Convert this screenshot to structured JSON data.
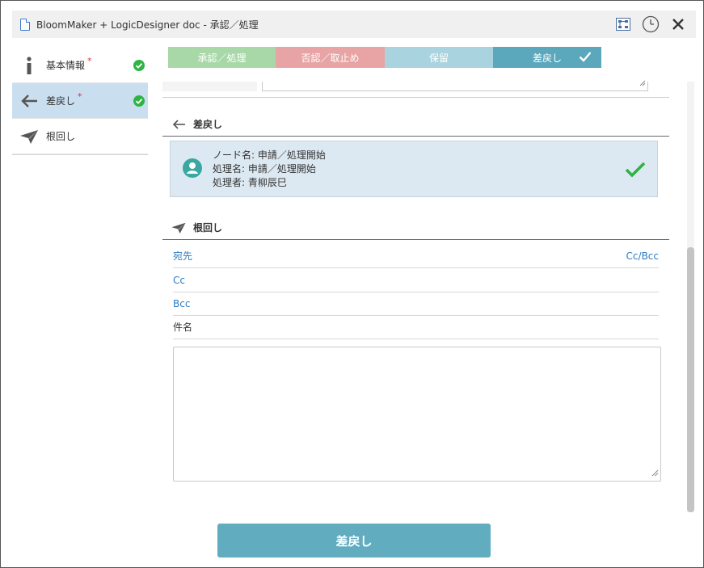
{
  "window": {
    "title": "BloomMaker + LogicDesigner doc - 承認／処理"
  },
  "sidebar": {
    "items": [
      {
        "label": "基本情報",
        "required_mark": "*",
        "icon": "info-icon",
        "status_icon": "check-circle-icon"
      },
      {
        "label": "差戻し",
        "required_mark": "*",
        "icon": "arrow-left-icon",
        "status_icon": "check-circle-icon"
      },
      {
        "label": "根回し",
        "icon": "paper-plane-icon"
      }
    ]
  },
  "actions": [
    {
      "label": "承認／処理",
      "color": "#a8d8a8"
    },
    {
      "label": "否認／取止め",
      "color": "#e8a4a4"
    },
    {
      "label": "保留",
      "color": "#a8d3df"
    },
    {
      "label": "差戻し",
      "color": "#5ba7bc",
      "selected": true
    }
  ],
  "return_section": {
    "heading": "差戻し",
    "node_line": "ノード名: 申請／処理開始",
    "process_line": "処理名: 申請／処理開始",
    "handler_line": "処理者: 青柳辰巳"
  },
  "nemawashi_section": {
    "heading": "根回し",
    "to_label": "宛先",
    "cc_bcc_link": "Cc/Bcc",
    "cc_label": "Cc",
    "bcc_label": "Bcc",
    "subject_label": "件名"
  },
  "submit": {
    "label": "差戻し"
  },
  "colors": {
    "accent": "#62acc0",
    "link": "#2b7cc2",
    "success": "#2fb344",
    "active_sidebar": "#c9dff0"
  }
}
